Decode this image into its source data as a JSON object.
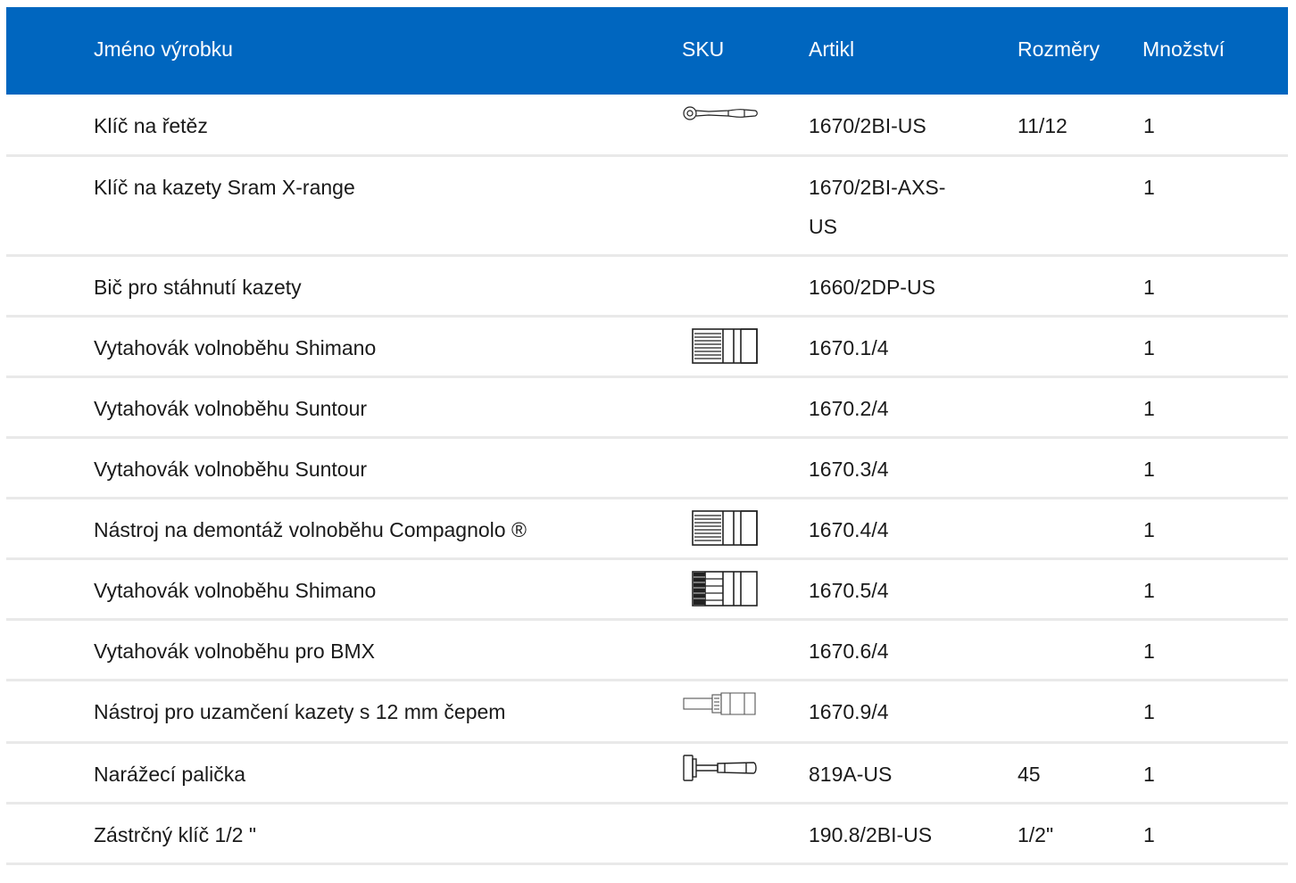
{
  "header": {
    "name": "Jméno výrobku",
    "sku": "SKU",
    "article": "Artikl",
    "dimensions": "Rozměry",
    "quantity": "Množství"
  },
  "rows": [
    {
      "name": "Klíč na řetěz",
      "article": "1670/2BI-US",
      "dimensions": "11/12",
      "quantity": "1",
      "icon": "ratchet-icon"
    },
    {
      "name": "Klíč na kazety Sram X-range",
      "article": "1670/2BI-AXS-US",
      "dimensions": "",
      "quantity": "1",
      "icon": ""
    },
    {
      "name": "Bič pro stáhnutí kazety",
      "article": "1660/2DP-US",
      "dimensions": "",
      "quantity": "1",
      "icon": ""
    },
    {
      "name": "Vytahovák volnoběhu Shimano",
      "article": "1670.1/4",
      "dimensions": "",
      "quantity": "1",
      "icon": "freewheel-tool-icon"
    },
    {
      "name": "Vytahovák volnoběhu Suntour",
      "article": "1670.2/4",
      "dimensions": "",
      "quantity": "1",
      "icon": ""
    },
    {
      "name": "Vytahovák volnoběhu Suntour",
      "article": "1670.3/4",
      "dimensions": "",
      "quantity": "1",
      "icon": ""
    },
    {
      "name": "Nástroj na demontáž volnoběhu Compagnolo ®",
      "article": "1670.4/4",
      "dimensions": "",
      "quantity": "1",
      "icon": "freewheel-tool-icon"
    },
    {
      "name": "Vytahovák volnoběhu Shimano",
      "article": "1670.5/4",
      "dimensions": "",
      "quantity": "1",
      "icon": "freewheel-tool-dense-icon"
    },
    {
      "name": "Vytahovák volnoběhu pro BMX",
      "article": "1670.6/4",
      "dimensions": "",
      "quantity": "1",
      "icon": ""
    },
    {
      "name": "Nástroj pro uzamčení kazety s 12 mm čepem",
      "article": "1670.9/4",
      "dimensions": "",
      "quantity": "1",
      "icon": "lockring-tool-icon"
    },
    {
      "name": "Narážecí palička",
      "article": "819A-US",
      "dimensions": "45",
      "quantity": "1",
      "icon": "hammer-icon"
    },
    {
      "name": "Zástrčný klíč 1/2 \"",
      "article": "190.8/2BI-US",
      "dimensions": "1/2\"",
      "quantity": "1",
      "icon": ""
    }
  ]
}
